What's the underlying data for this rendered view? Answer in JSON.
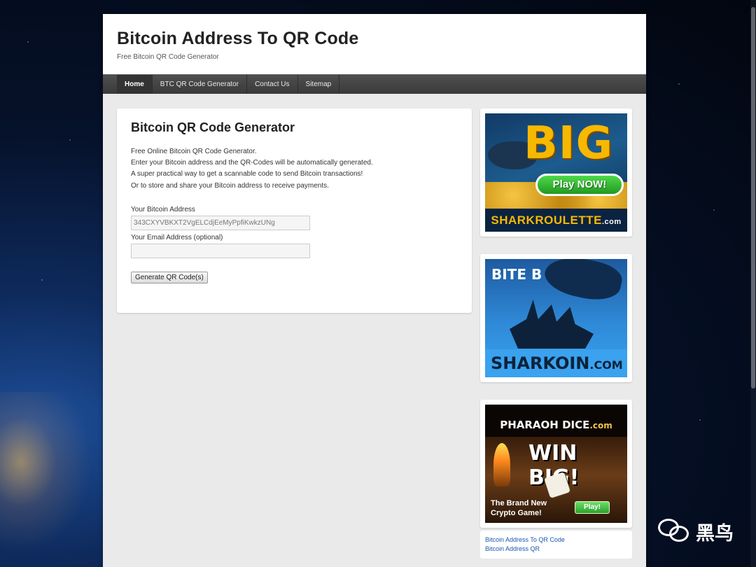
{
  "site": {
    "title": "Bitcoin Address To QR Code",
    "description": "Free Bitcoin QR Code Generator"
  },
  "nav": [
    {
      "label": "Home",
      "active": true
    },
    {
      "label": "BTC QR Code Generator",
      "active": false
    },
    {
      "label": "Contact Us",
      "active": false
    },
    {
      "label": "Sitemap",
      "active": false
    }
  ],
  "main": {
    "title": "Bitcoin QR Code Generator",
    "intro": [
      "Free Online Bitcoin QR Code Generator.",
      "Enter your Bitcoin address and the QR-Codes will be automatically generated.",
      "A super practical way to get a scannable code to send Bitcoin transactions!",
      "Or to store and share your Bitcoin address to receive payments."
    ],
    "form": {
      "address_label": "Your Bitcoin Address",
      "address_value": "343CXYVBKXT2VgELCdjEeMyPpfiKwkzUNg",
      "email_label": "Your Email Address (optional)",
      "email_value": "",
      "submit_label": "Generate QR Code(s)"
    }
  },
  "sidebar": {
    "ads": [
      {
        "name": "shark-roulette",
        "big_text": "BIG",
        "button": "Play NOW!",
        "brand": "SHARKROULETTE",
        "brand_suffix": ".com"
      },
      {
        "name": "sharkoin",
        "headline": "BITE B",
        "brand": "SHARKOIN",
        "brand_suffix": ".COM"
      },
      {
        "name": "pharaoh-dice",
        "brand": "PHARAOH",
        "brand_mid": "DICE",
        "brand_suffix": ".com",
        "headline": "WIN BIG!",
        "tagline_1": "The Brand New",
        "tagline_2": "Crypto Game!",
        "button": "Play!"
      }
    ],
    "links": [
      "Bitcoin Address To QR Code",
      "Bitcoin Address QR"
    ]
  },
  "watermark": {
    "text": "黑鸟"
  },
  "colors": {
    "nav_bg": "#444444",
    "content_bg": "#eaeaea",
    "link": "#1b57b1"
  }
}
